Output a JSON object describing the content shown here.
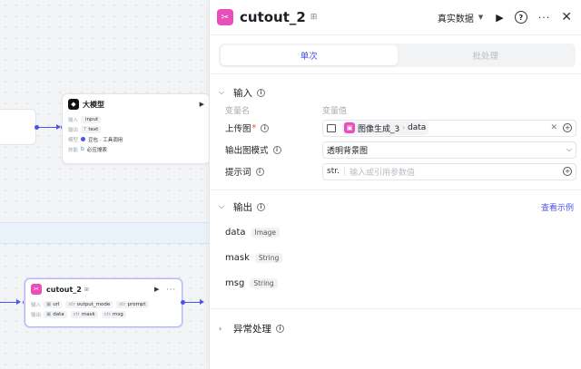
{
  "canvas": {
    "llm_node": {
      "title": "大模型",
      "rows": [
        {
          "label": "输入",
          "type": "",
          "value": "input"
        },
        {
          "label": "输出",
          "type": "T",
          "value": "text"
        },
        {
          "label": "模型",
          "value": "豆包 · 工具调用"
        },
        {
          "label": "技能",
          "value": "必应搜索"
        }
      ]
    },
    "cutout_node": {
      "title": "cutout_2",
      "inputs_label": "输入",
      "outputs_label": "输出",
      "inputs": [
        {
          "type": "",
          "value": "url"
        },
        {
          "type": "str",
          "value": "output_mode"
        },
        {
          "type": "str",
          "value": "prompt"
        }
      ],
      "outputs": [
        {
          "type": "",
          "value": "data"
        },
        {
          "type": "str",
          "value": "mask"
        },
        {
          "type": "str",
          "value": "msg"
        }
      ]
    }
  },
  "panel": {
    "title": "cutout_2",
    "data_source": "真实数据",
    "tabs": [
      {
        "label": "单次",
        "active": true
      },
      {
        "label": "批处理",
        "active": false
      }
    ],
    "input_section": {
      "title": "输入",
      "col_name": "变量名",
      "col_value": "变量值",
      "fields": [
        {
          "label": "上传图",
          "required": true,
          "ref_node": "图像生成_3",
          "ref_var": "data"
        },
        {
          "label": "输出图模式",
          "value": "透明背景图"
        },
        {
          "label": "提示词",
          "prefix": "str.",
          "placeholder": "输入或引用参数值"
        }
      ]
    },
    "output_section": {
      "title": "输出",
      "view_example": "查看示例",
      "outputs": [
        {
          "name": "data",
          "type": "Image"
        },
        {
          "name": "mask",
          "type": "String"
        },
        {
          "name": "msg",
          "type": "String"
        }
      ]
    },
    "exception_section": {
      "title": "异常处理"
    }
  }
}
